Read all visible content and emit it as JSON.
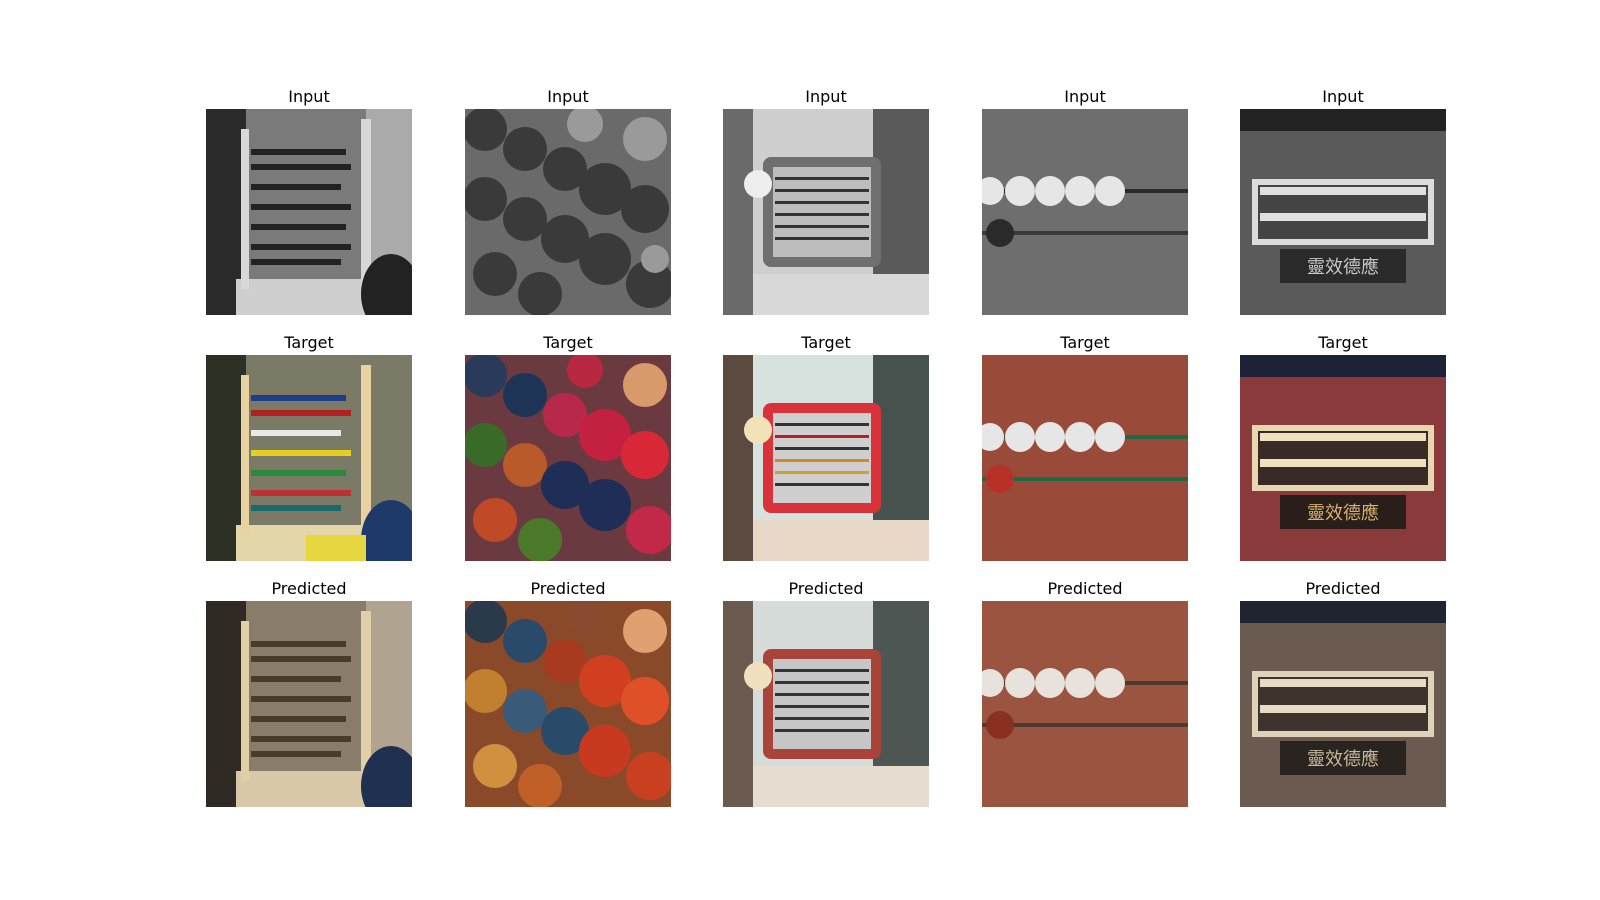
{
  "rows": [
    {
      "title": "Input",
      "tone": "gray"
    },
    {
      "title": "Target",
      "tone": "color"
    },
    {
      "title": "Predicted",
      "tone": "pred"
    }
  ],
  "columns": [
    {
      "subject": "abacus-frame"
    },
    {
      "subject": "bead-closeup"
    },
    {
      "subject": "abacus-red-frame"
    },
    {
      "subject": "beads-on-rod"
    },
    {
      "subject": "chinese-abacus-sign",
      "sign_text": "靈效德應"
    }
  ]
}
